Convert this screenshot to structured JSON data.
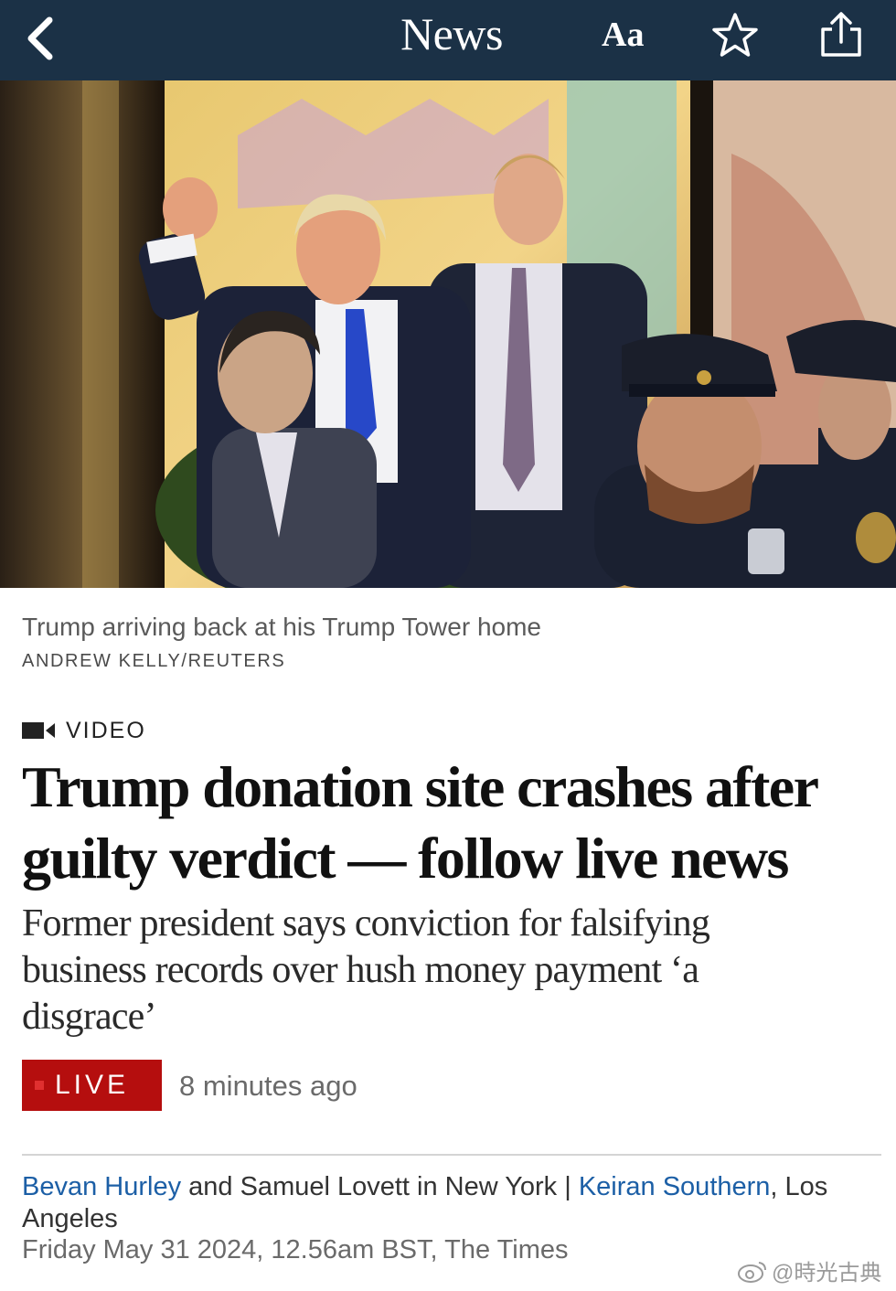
{
  "nav": {
    "title": "News",
    "font_size_label": "Aa",
    "icons": [
      "back-chevron-icon",
      "star-icon",
      "share-icon"
    ],
    "bar_color": "#1b3146"
  },
  "hero": {
    "caption": "Trump arriving back at his Trump Tower home",
    "credit": "ANDREW KELLY/REUTERS"
  },
  "article": {
    "tag": "VIDEO",
    "headline_line1": "Trump donation site crashes after",
    "headline_line2": "guilty verdict — follow live news",
    "standfirst": "Former president says conviction for falsifying business records over hush money payment ‘a disgrace’",
    "live_label": "LIVE",
    "live_color": "#b50e0e",
    "updated": "8 minutes ago",
    "byline": {
      "author1": "Bevan Hurley",
      "text1": " and Samuel Lovett in New York | ",
      "author2": "Keiran Southern",
      "text2": ", Los Angeles"
    },
    "dateline": "Friday May 31 2024, 12.56am BST, The Times",
    "link_color": "#1c5fa6"
  },
  "watermark": "@時光古典"
}
